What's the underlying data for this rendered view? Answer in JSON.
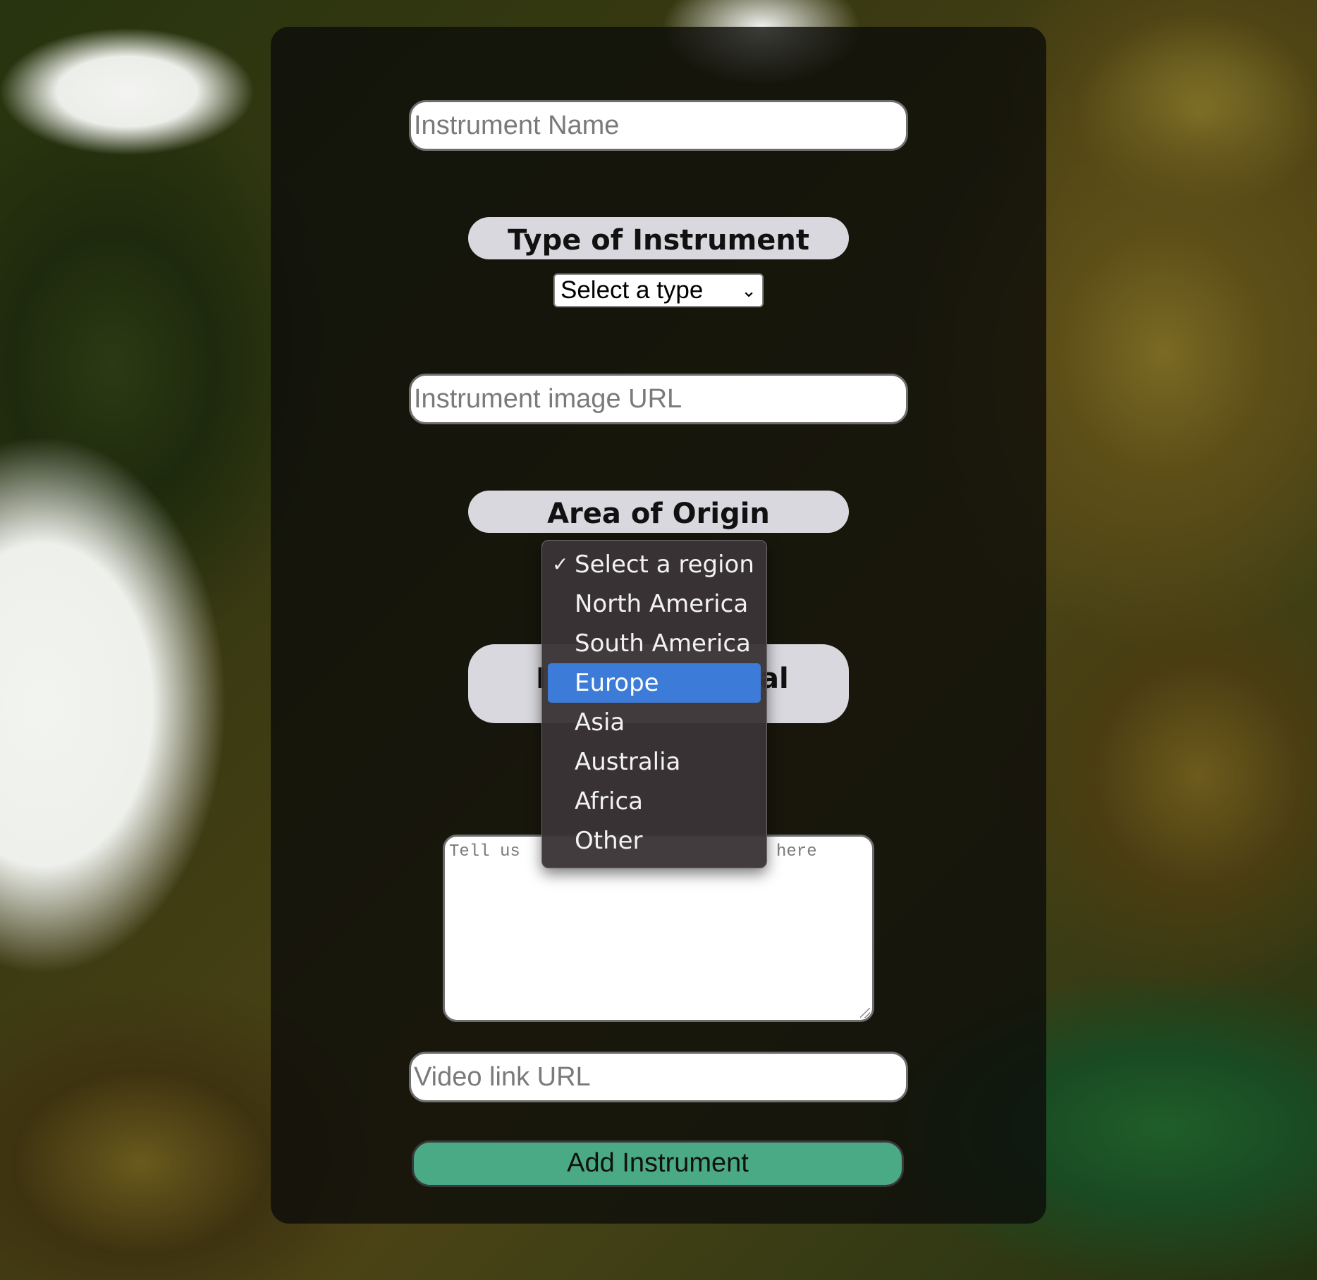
{
  "form": {
    "instrument_name_placeholder": "Instrument Name",
    "type_label": "Type of Instrument",
    "type_select_value": "Select a type",
    "image_url_placeholder": "Instrument image URL",
    "origin_label": "Area of Origin",
    "hidden_label_left_fragment": "I",
    "hidden_label_right_fragment": "al",
    "description_placeholder_left": "Tell us",
    "description_placeholder_right": "here",
    "video_url_placeholder": "Video link URL",
    "submit_label": "Add Instrument"
  },
  "region_dropdown": {
    "selected": "Select a region",
    "highlighted": "Europe",
    "check_icon": "✓",
    "options": [
      "Select a region",
      "North America",
      "South America",
      "Europe",
      "Asia",
      "Australia",
      "Africa",
      "Other"
    ]
  },
  "colors": {
    "accent_button": "#4aaa86",
    "highlight": "#3d7bd8",
    "panel": "rgba(12,12,10,0.80)",
    "label_pill": "#d8d8de"
  }
}
